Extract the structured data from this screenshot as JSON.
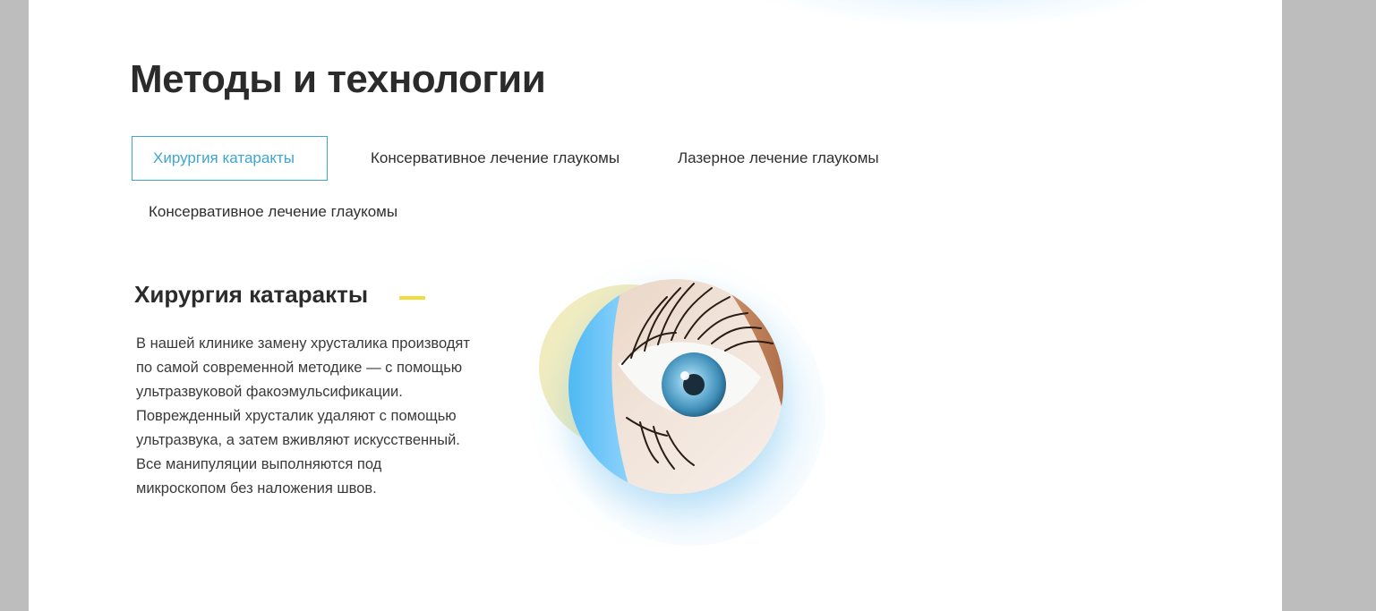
{
  "section": {
    "title": "Методы и технологии"
  },
  "tabs": [
    {
      "label": "Хирургия катаракты",
      "active": true
    },
    {
      "label": "Консервативное лечение глаукомы",
      "active": false
    },
    {
      "label": "Лазерное лечение глаукомы",
      "active": false
    },
    {
      "label": "Консервативное лечение глаукомы",
      "active": false
    }
  ],
  "content": {
    "title": "Хирургия катаракты",
    "description_lines": [
      "В нашей клинике замену хрусталика производят",
      "по самой современной методике — с помощью",
      "ультразвуковой факоэмульсификации.",
      "Поврежденный хрусталик удаляют с помощью",
      "ультразвука, а затем вживляют искусственный.",
      "Все манипуляции выполняются под",
      "микроскопом без наложения швов."
    ],
    "image": "eye-photo"
  },
  "colors": {
    "accent_blue": "#3ea6d4",
    "accent_yellow": "#f2dc3c",
    "heading": "#2b2b2b",
    "outer_background": "#bdbdbd"
  }
}
